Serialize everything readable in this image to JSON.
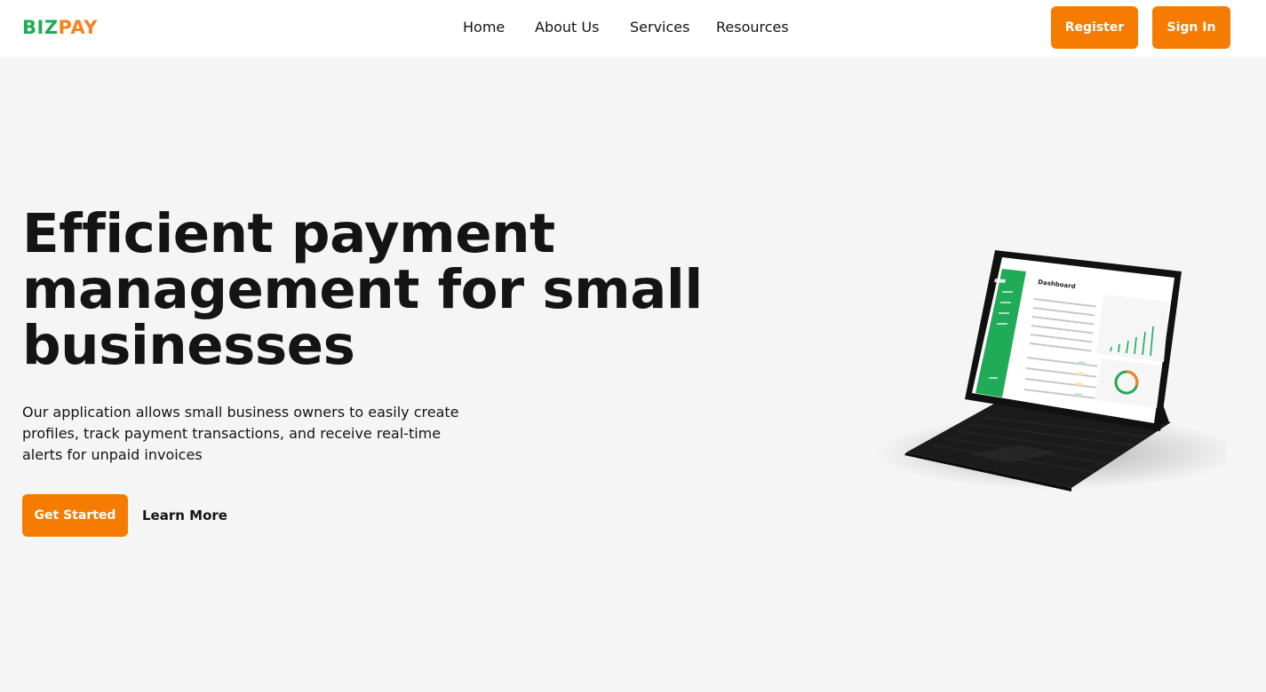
{
  "brand": {
    "logo_part1": "BIZ",
    "logo_part2": "PAY",
    "colors": {
      "green": "#1fab57",
      "orange": "#f5841f"
    }
  },
  "nav": {
    "items": [
      "Home",
      "About Us",
      "Services",
      "Resources"
    ]
  },
  "header_actions": {
    "register_label": "Register",
    "signin_label": "Sign In"
  },
  "hero": {
    "headline_line1": "Efficient payment",
    "headline_line2": "management for small",
    "headline_line3": "businesses",
    "subtext_line1": "Our application allows small business owners to easily create",
    "subtext_line2": "profiles, track payment transactions, and receive real-time",
    "subtext_line3": "alerts for unpaid invoices",
    "cta_primary": "Get Started",
    "cta_secondary": "Learn More"
  },
  "illustration": {
    "screen_title": "Dashboard",
    "accent": "#1fab57",
    "button_color": "#f57c00"
  }
}
